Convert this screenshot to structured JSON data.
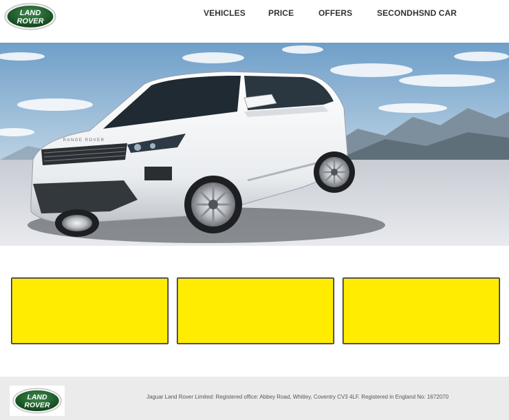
{
  "brand": {
    "logo_line1": "LAND",
    "logo_line2": "ROVER",
    "colors": {
      "logo_green": "#1f5c2c",
      "logo_border": "#c9c9c9",
      "card_yellow": "#ffec00",
      "footer_bg": "#ebebeb"
    }
  },
  "nav": {
    "items": [
      {
        "label": "VEHICLES"
      },
      {
        "label": "PRICE"
      },
      {
        "label": "OFFERS"
      },
      {
        "label": "SECONDHSND CAR"
      }
    ]
  },
  "hero": {
    "image": "white-range-rover-evoque-photo",
    "grille_text": "RANGE ROVER"
  },
  "cards": [
    {
      "color": "#ffec00"
    },
    {
      "color": "#ffec00"
    },
    {
      "color": "#ffec00"
    }
  ],
  "footer": {
    "legal_text": "Jaguar Land Rover Limited: Registered office: Abbey Road, Whitley, Coventry CV3 4LF. Registered in England No: 1672070"
  }
}
